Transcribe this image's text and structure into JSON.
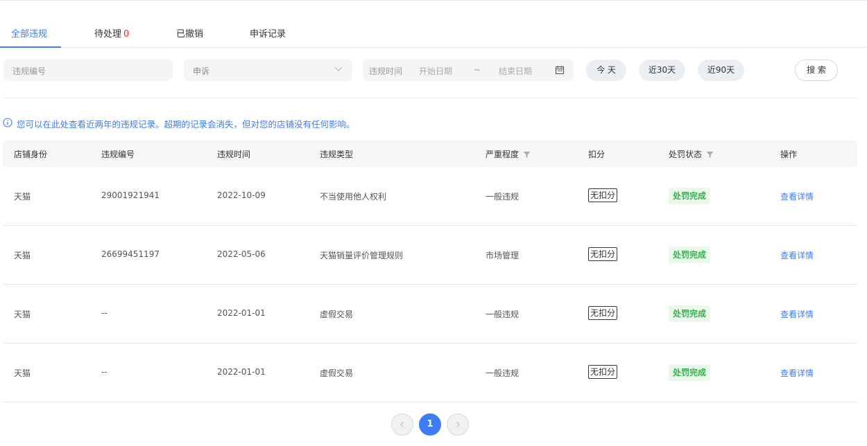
{
  "tabs": [
    {
      "label": "全部违规"
    },
    {
      "label": "待处理",
      "count": "0"
    },
    {
      "label": "已撤销"
    },
    {
      "label": "申诉记录"
    }
  ],
  "filters": {
    "violation_no_placeholder": "违规编号",
    "appeal_select": "申诉",
    "date_label": "违规时间",
    "start_placeholder": "开始日期",
    "tilde": "~",
    "end_placeholder": "结束日期",
    "quick_today": "今 天",
    "quick_30": "近30天",
    "quick_90": "近90天",
    "search": "搜 索"
  },
  "notice": "您可以在此处查看近两年的违规记录。超期的记录会消失，但对您的店铺没有任何影响。",
  "table": {
    "headers": {
      "shop_identity": "店铺身份",
      "violation_no": "违规编号",
      "violation_time": "违规时间",
      "violation_type": "违规类型",
      "severity": "严重程度",
      "deduction": "扣分",
      "penalty_status": "处罚状态",
      "operation": "操作"
    },
    "rows": [
      {
        "shop": "天猫",
        "no": "29001921941",
        "time": "2022-10-09",
        "type": "不当使用他人权利",
        "severity": "一般违规",
        "deduction": "无扣分",
        "status": "处罚完成",
        "action": "查看详情"
      },
      {
        "shop": "天猫",
        "no": "26699451197",
        "time": "2022-05-06",
        "type": "天猫销量评价管理规则",
        "severity": "市场管理",
        "deduction": "无扣分",
        "status": "处罚完成",
        "action": "查看详情"
      },
      {
        "shop": "天猫",
        "no": "--",
        "time": "2022-01-01",
        "type": "虚假交易",
        "severity": "一般违规",
        "deduction": "无扣分",
        "status": "处罚完成",
        "action": "查看详情"
      },
      {
        "shop": "天猫",
        "no": "--",
        "time": "2022-01-01",
        "type": "虚假交易",
        "severity": "一般违规",
        "deduction": "无扣分",
        "status": "处罚完成",
        "action": "查看详情"
      }
    ]
  },
  "pagination": {
    "current": "1"
  },
  "colors": {
    "accent": "#3d7bf7",
    "status_green": "#34b24d",
    "alert_red": "#f5222d"
  },
  "icons": [
    "info-icon",
    "chevron-down-icon",
    "calendar-icon",
    "filter-icon",
    "chevron-left-icon",
    "chevron-right-icon"
  ]
}
